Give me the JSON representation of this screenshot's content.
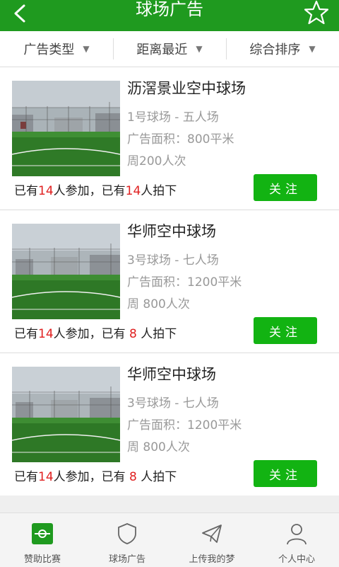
{
  "header": {
    "title": "球场广告",
    "back_icon": "chevron-left-icon",
    "star_icon": "star-outline-icon"
  },
  "filters": [
    {
      "label": "广告类型",
      "arrow": "▼"
    },
    {
      "label": "距离最近",
      "arrow": "▼"
    },
    {
      "label": "综合排序",
      "arrow": "▼"
    }
  ],
  "items": [
    {
      "name": "沥滘景业空中球场",
      "field": "1号球场 - 五人场",
      "area": "广告面积：800平米",
      "weekly": "周200人次",
      "s_pre": "已有",
      "joined": "14",
      "s_mid": "人参加，已有",
      "shot": "14",
      "s_post": "人拍下",
      "button": "关注"
    },
    {
      "name": "华师空中球场",
      "field": "3号球场 - 七人场",
      "area": "广告面积：1200平米",
      "weekly": "周 800人次",
      "s_pre": "已有",
      "joined": "14",
      "s_mid": "人参加，已有",
      "shot": " 8 ",
      "s_post": "人拍下",
      "button": "关注"
    },
    {
      "name": "华师空中球场",
      "field": "3号球场 - 七人场",
      "area": "广告面积：1200平米",
      "weekly": "周 800人次",
      "s_pre": "已有",
      "joined": "14",
      "s_mid": "人参加，已有",
      "shot": " 8 ",
      "s_post": "人拍下",
      "button": "关注"
    }
  ],
  "tabs": [
    {
      "label": "赞助比赛",
      "icon": "whistle-icon",
      "active": true
    },
    {
      "label": "球场广告",
      "icon": "shield-icon",
      "active": false
    },
    {
      "label": "上传我的梦",
      "icon": "paper-plane-icon",
      "active": false
    },
    {
      "label": "个人中心",
      "icon": "user-icon",
      "active": false
    }
  ],
  "colors": {
    "header": "#1f9a1f",
    "button": "#12b312",
    "highlight": "#e02020",
    "tab_active": "#1f9a1f"
  }
}
